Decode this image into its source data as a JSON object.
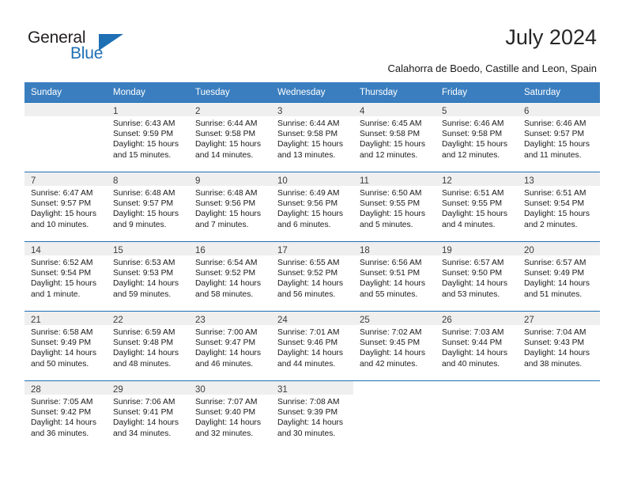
{
  "brand": {
    "name_part1": "General",
    "name_part2": "Blue",
    "accent_color": "#1f6fb5"
  },
  "header": {
    "title": "July 2024",
    "location": "Calahorra de Boedo, Castille and Leon, Spain"
  },
  "calendar": {
    "header_bg": "#3a7ebf",
    "daynum_band_bg": "#efefef",
    "weekday_headers": [
      "Sunday",
      "Monday",
      "Tuesday",
      "Wednesday",
      "Thursday",
      "Friday",
      "Saturday"
    ],
    "weeks": [
      [
        {
          "day": "",
          "sunrise": "",
          "sunset": "",
          "daylight_1": "",
          "daylight_2": "",
          "empty": true
        },
        {
          "day": "1",
          "sunrise": "Sunrise: 6:43 AM",
          "sunset": "Sunset: 9:59 PM",
          "daylight_1": "Daylight: 15 hours",
          "daylight_2": "and 15 minutes."
        },
        {
          "day": "2",
          "sunrise": "Sunrise: 6:44 AM",
          "sunset": "Sunset: 9:58 PM",
          "daylight_1": "Daylight: 15 hours",
          "daylight_2": "and 14 minutes."
        },
        {
          "day": "3",
          "sunrise": "Sunrise: 6:44 AM",
          "sunset": "Sunset: 9:58 PM",
          "daylight_1": "Daylight: 15 hours",
          "daylight_2": "and 13 minutes."
        },
        {
          "day": "4",
          "sunrise": "Sunrise: 6:45 AM",
          "sunset": "Sunset: 9:58 PM",
          "daylight_1": "Daylight: 15 hours",
          "daylight_2": "and 12 minutes."
        },
        {
          "day": "5",
          "sunrise": "Sunrise: 6:46 AM",
          "sunset": "Sunset: 9:58 PM",
          "daylight_1": "Daylight: 15 hours",
          "daylight_2": "and 12 minutes."
        },
        {
          "day": "6",
          "sunrise": "Sunrise: 6:46 AM",
          "sunset": "Sunset: 9:57 PM",
          "daylight_1": "Daylight: 15 hours",
          "daylight_2": "and 11 minutes."
        }
      ],
      [
        {
          "day": "7",
          "sunrise": "Sunrise: 6:47 AM",
          "sunset": "Sunset: 9:57 PM",
          "daylight_1": "Daylight: 15 hours",
          "daylight_2": "and 10 minutes."
        },
        {
          "day": "8",
          "sunrise": "Sunrise: 6:48 AM",
          "sunset": "Sunset: 9:57 PM",
          "daylight_1": "Daylight: 15 hours",
          "daylight_2": "and 9 minutes."
        },
        {
          "day": "9",
          "sunrise": "Sunrise: 6:48 AM",
          "sunset": "Sunset: 9:56 PM",
          "daylight_1": "Daylight: 15 hours",
          "daylight_2": "and 7 minutes."
        },
        {
          "day": "10",
          "sunrise": "Sunrise: 6:49 AM",
          "sunset": "Sunset: 9:56 PM",
          "daylight_1": "Daylight: 15 hours",
          "daylight_2": "and 6 minutes."
        },
        {
          "day": "11",
          "sunrise": "Sunrise: 6:50 AM",
          "sunset": "Sunset: 9:55 PM",
          "daylight_1": "Daylight: 15 hours",
          "daylight_2": "and 5 minutes."
        },
        {
          "day": "12",
          "sunrise": "Sunrise: 6:51 AM",
          "sunset": "Sunset: 9:55 PM",
          "daylight_1": "Daylight: 15 hours",
          "daylight_2": "and 4 minutes."
        },
        {
          "day": "13",
          "sunrise": "Sunrise: 6:51 AM",
          "sunset": "Sunset: 9:54 PM",
          "daylight_1": "Daylight: 15 hours",
          "daylight_2": "and 2 minutes."
        }
      ],
      [
        {
          "day": "14",
          "sunrise": "Sunrise: 6:52 AM",
          "sunset": "Sunset: 9:54 PM",
          "daylight_1": "Daylight: 15 hours",
          "daylight_2": "and 1 minute."
        },
        {
          "day": "15",
          "sunrise": "Sunrise: 6:53 AM",
          "sunset": "Sunset: 9:53 PM",
          "daylight_1": "Daylight: 14 hours",
          "daylight_2": "and 59 minutes."
        },
        {
          "day": "16",
          "sunrise": "Sunrise: 6:54 AM",
          "sunset": "Sunset: 9:52 PM",
          "daylight_1": "Daylight: 14 hours",
          "daylight_2": "and 58 minutes."
        },
        {
          "day": "17",
          "sunrise": "Sunrise: 6:55 AM",
          "sunset": "Sunset: 9:52 PM",
          "daylight_1": "Daylight: 14 hours",
          "daylight_2": "and 56 minutes."
        },
        {
          "day": "18",
          "sunrise": "Sunrise: 6:56 AM",
          "sunset": "Sunset: 9:51 PM",
          "daylight_1": "Daylight: 14 hours",
          "daylight_2": "and 55 minutes."
        },
        {
          "day": "19",
          "sunrise": "Sunrise: 6:57 AM",
          "sunset": "Sunset: 9:50 PM",
          "daylight_1": "Daylight: 14 hours",
          "daylight_2": "and 53 minutes."
        },
        {
          "day": "20",
          "sunrise": "Sunrise: 6:57 AM",
          "sunset": "Sunset: 9:49 PM",
          "daylight_1": "Daylight: 14 hours",
          "daylight_2": "and 51 minutes."
        }
      ],
      [
        {
          "day": "21",
          "sunrise": "Sunrise: 6:58 AM",
          "sunset": "Sunset: 9:49 PM",
          "daylight_1": "Daylight: 14 hours",
          "daylight_2": "and 50 minutes."
        },
        {
          "day": "22",
          "sunrise": "Sunrise: 6:59 AM",
          "sunset": "Sunset: 9:48 PM",
          "daylight_1": "Daylight: 14 hours",
          "daylight_2": "and 48 minutes."
        },
        {
          "day": "23",
          "sunrise": "Sunrise: 7:00 AM",
          "sunset": "Sunset: 9:47 PM",
          "daylight_1": "Daylight: 14 hours",
          "daylight_2": "and 46 minutes."
        },
        {
          "day": "24",
          "sunrise": "Sunrise: 7:01 AM",
          "sunset": "Sunset: 9:46 PM",
          "daylight_1": "Daylight: 14 hours",
          "daylight_2": "and 44 minutes."
        },
        {
          "day": "25",
          "sunrise": "Sunrise: 7:02 AM",
          "sunset": "Sunset: 9:45 PM",
          "daylight_1": "Daylight: 14 hours",
          "daylight_2": "and 42 minutes."
        },
        {
          "day": "26",
          "sunrise": "Sunrise: 7:03 AM",
          "sunset": "Sunset: 9:44 PM",
          "daylight_1": "Daylight: 14 hours",
          "daylight_2": "and 40 minutes."
        },
        {
          "day": "27",
          "sunrise": "Sunrise: 7:04 AM",
          "sunset": "Sunset: 9:43 PM",
          "daylight_1": "Daylight: 14 hours",
          "daylight_2": "and 38 minutes."
        }
      ],
      [
        {
          "day": "28",
          "sunrise": "Sunrise: 7:05 AM",
          "sunset": "Sunset: 9:42 PM",
          "daylight_1": "Daylight: 14 hours",
          "daylight_2": "and 36 minutes."
        },
        {
          "day": "29",
          "sunrise": "Sunrise: 7:06 AM",
          "sunset": "Sunset: 9:41 PM",
          "daylight_1": "Daylight: 14 hours",
          "daylight_2": "and 34 minutes."
        },
        {
          "day": "30",
          "sunrise": "Sunrise: 7:07 AM",
          "sunset": "Sunset: 9:40 PM",
          "daylight_1": "Daylight: 14 hours",
          "daylight_2": "and 32 minutes."
        },
        {
          "day": "31",
          "sunrise": "Sunrise: 7:08 AM",
          "sunset": "Sunset: 9:39 PM",
          "daylight_1": "Daylight: 14 hours",
          "daylight_2": "and 30 minutes."
        },
        {
          "day": "",
          "sunrise": "",
          "sunset": "",
          "daylight_1": "",
          "daylight_2": "",
          "empty": true
        },
        {
          "day": "",
          "sunrise": "",
          "sunset": "",
          "daylight_1": "",
          "daylight_2": "",
          "empty": true
        },
        {
          "day": "",
          "sunrise": "",
          "sunset": "",
          "daylight_1": "",
          "daylight_2": "",
          "empty": true
        }
      ]
    ]
  }
}
